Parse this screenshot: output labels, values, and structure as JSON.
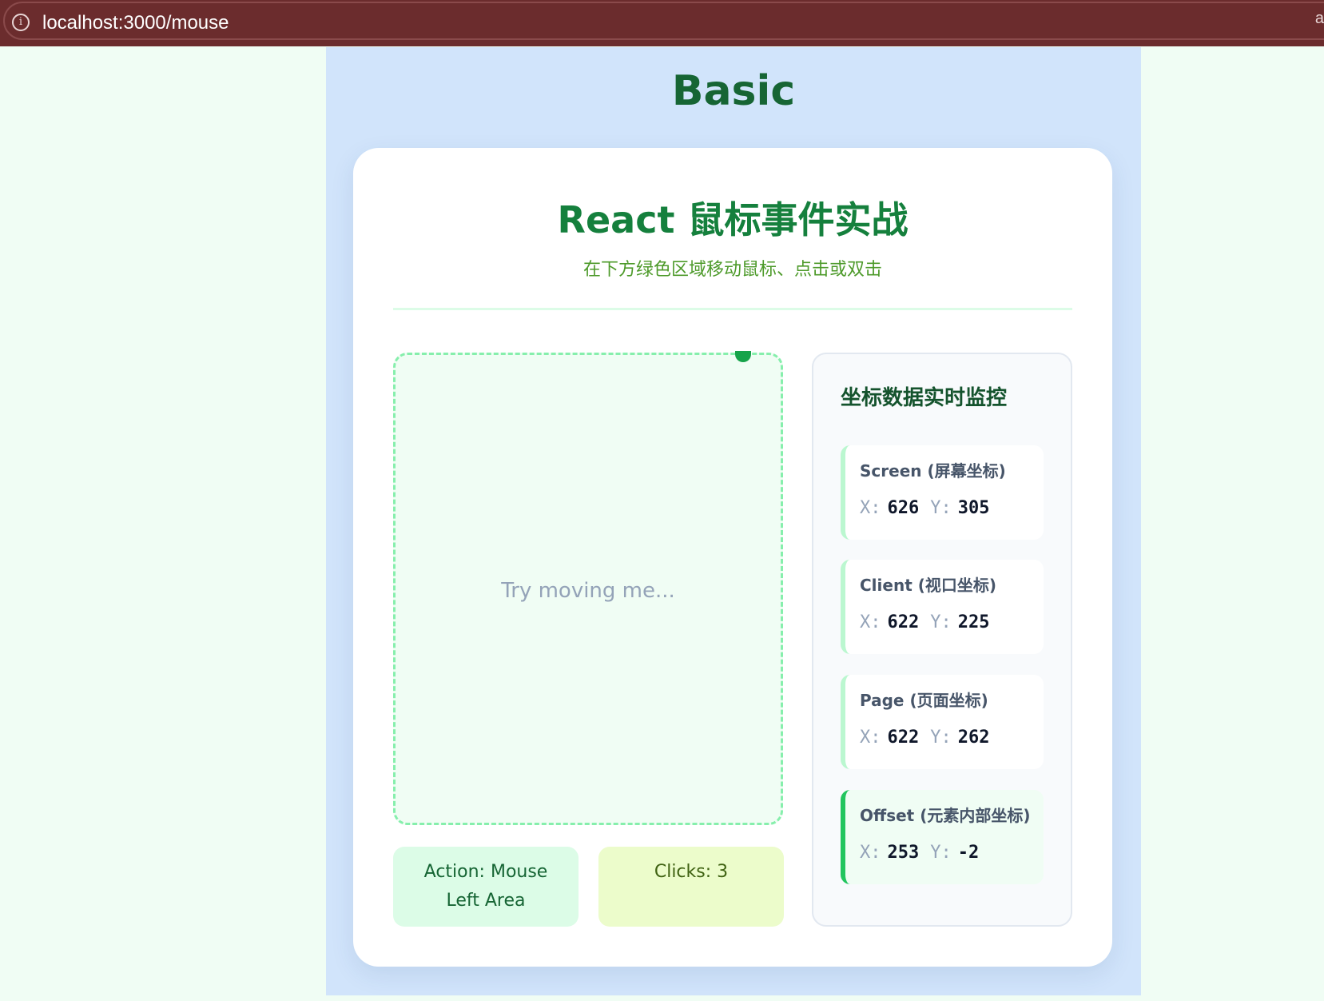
{
  "browser": {
    "url": "localhost:3000/mouse",
    "edge_glyph": "a"
  },
  "page": {
    "title": "Basic"
  },
  "card": {
    "title": "React 鼠标事件实战",
    "subtitle": "在下方绿色区域移动鼠标、点击或双击"
  },
  "track_area": {
    "hint": "Try moving me..."
  },
  "status": {
    "action_line1": "Action: Mouse",
    "action_line2": "Left Area",
    "clicks": "Clicks: 3"
  },
  "monitor": {
    "title": "坐标数据实时监控",
    "coords": [
      {
        "label": "Screen (屏幕坐标)",
        "x_label": "X:",
        "x": "626",
        "y_label": "Y:",
        "y": "305"
      },
      {
        "label": "Client (视口坐标)",
        "x_label": "X:",
        "x": "622",
        "y_label": "Y:",
        "y": "225"
      },
      {
        "label": "Page (页面坐标)",
        "x_label": "X:",
        "x": "622",
        "y_label": "Y:",
        "y": "262"
      },
      {
        "label": "Offset (元素内部坐标)",
        "x_label": "X:",
        "x": "253",
        "y_label": "Y:",
        "y": "-2"
      }
    ]
  },
  "colors": {
    "url_bar": "#6b2c2d",
    "page_bg": "#d1e4fb",
    "accent_green": "#15803d",
    "dot": "#16a34a"
  }
}
